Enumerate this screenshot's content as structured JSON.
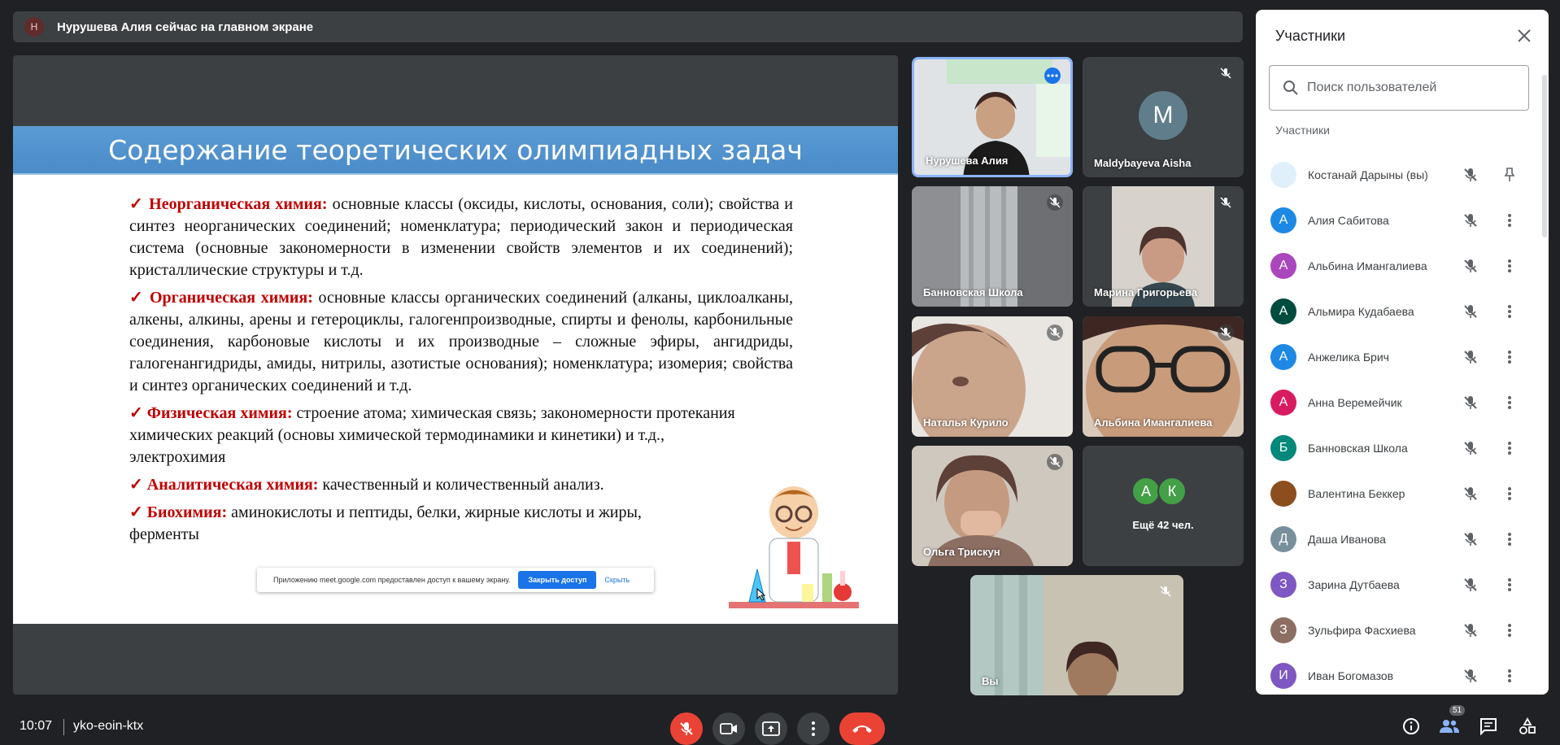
{
  "banner": {
    "avatar_letter": "Н",
    "text": "Нурушева Алия сейчас на главном экране"
  },
  "slide": {
    "title": "Содержание теоретических олимпиадных задач",
    "items": [
      {
        "check": "✓",
        "heading": "Неорганическая химия:",
        "text": " основные классы (оксиды, кислоты, основания, соли); свойства и синтез неорганических соединений; номенклатура; периодический закон и периодическая система (основные закономерности в изменении свойств элементов и их соединений); кристаллические структуры и т.д."
      },
      {
        "check": "✓",
        "heading": "Органическая химия:",
        "text": " основные классы органических соединений (алканы, циклоалканы, алкены, алкины, арены и гетероциклы, галогенпроизводные, спирты и фенолы, карбонильные соединения, карбоновые кислоты и их производные – сложные эфиры, ангидриды, галогенангидриды, амиды, нитрилы, азотистые основания); номенклатура; изомерия; свойства и синтез органических соединений и т.д."
      },
      {
        "check": "✓ ",
        "heading": "Физическая химия:",
        "text": " строение атома; химическая связь; закономерности протекания химических реакций (основы химической термодинамики и кинетики) и т.д., электрохимия"
      },
      {
        "check": "✓",
        "heading": "Аналитическая химия:",
        "text": " качественный и количественный анализ."
      },
      {
        "check": "✓",
        "heading": "Биохимия:",
        "text": " аминокислоты и пептиды, белки, жирные кислоты и жиры, ферменты"
      }
    ]
  },
  "share_bar": {
    "text": "Приложению meet.google.com предоставлен доступ к вашему экрану.",
    "stop_label": "Закрыть доступ",
    "hide_label": "Скрыть"
  },
  "tiles": [
    {
      "name": "Нурушева Алия"
    },
    {
      "name": "Maldybayeva Aisha",
      "letter": "M"
    },
    {
      "name": "Банновская Школа"
    },
    {
      "name": "Марина Григорьева"
    },
    {
      "name": "Наталья Курило"
    },
    {
      "name": "Альбина Имангалиева"
    },
    {
      "name": "Ольга Трискун"
    },
    {
      "name": "Ещё 42 чел.",
      "letters": [
        "А",
        "К"
      ]
    },
    {
      "name": "Вы"
    }
  ],
  "panel": {
    "title": "Участники",
    "search_placeholder": "Поиск пользователей",
    "section": "Участники",
    "participants": [
      {
        "name": "Костанай Дарыны (вы)",
        "letter": "",
        "color": "#e0f0fa"
      },
      {
        "name": "Алия Сабитова",
        "letter": "А",
        "color": "#1e88e5"
      },
      {
        "name": "Альбина Имангалиева",
        "letter": "А",
        "color": "#ab47bc"
      },
      {
        "name": "Альмира Кудабаева",
        "letter": "А",
        "color": "#004d40"
      },
      {
        "name": "Анжелика Брич",
        "letter": "А",
        "color": "#1e88e5"
      },
      {
        "name": "Анна Веремейчик",
        "letter": "А",
        "color": "#d81b60"
      },
      {
        "name": "Банновская Школа",
        "letter": "Б",
        "color": "#00897b"
      },
      {
        "name": "Валентина Беккер",
        "letter": "",
        "color": "#8d4e1f"
      },
      {
        "name": "Даша Иванова",
        "letter": "Д",
        "color": "#78909c"
      },
      {
        "name": "Зарина Дутбаева",
        "letter": "З",
        "color": "#7e57c2"
      },
      {
        "name": "Зульфира Фасхиева",
        "letter": "З",
        "color": "#8d6e63"
      },
      {
        "name": "Иван Богомазов",
        "letter": "И",
        "color": "#7e57c2"
      }
    ]
  },
  "bottom": {
    "time": "10:07",
    "meeting_code": "yko-eoin-ktx",
    "participants_count": "51"
  },
  "colors": {
    "background": "#202124",
    "tile": "#3c4043",
    "end_call": "#ea4335",
    "accent": "#1a73e8"
  }
}
